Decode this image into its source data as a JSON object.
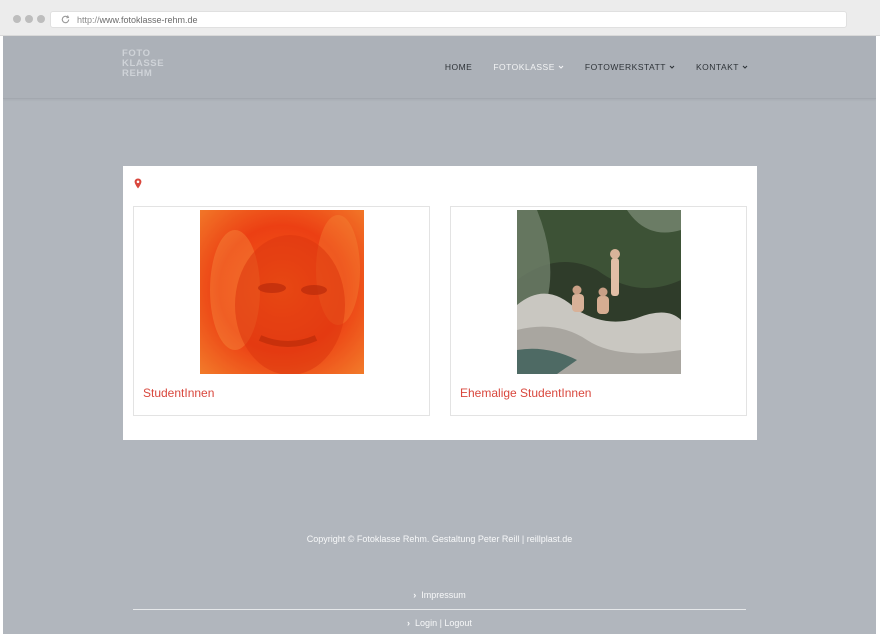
{
  "browser": {
    "url_prefix": "http://",
    "url_host": "www.fotoklasse-rehm.de"
  },
  "site": {
    "logo_lines": [
      "FOTO",
      "KLASSE",
      "REHM"
    ],
    "nav": [
      {
        "label": "HOME",
        "dropdown": false,
        "active": false
      },
      {
        "label": "FOTOKLASSE",
        "dropdown": true,
        "active": true
      },
      {
        "label": "FOTOWERKSTATT",
        "dropdown": true,
        "active": false
      },
      {
        "label": "KONTAKT",
        "dropdown": true,
        "active": false
      }
    ]
  },
  "content": {
    "tiles": [
      {
        "label": "StudentInnen"
      },
      {
        "label": "Ehemalige StudentInnen"
      }
    ]
  },
  "footer": {
    "copyright": "Copyright © Fotoklasse Rehm. Gestaltung Peter Reill | reillplast.de",
    "impressum": "Impressum",
    "login": "Login | Logout"
  },
  "colors": {
    "accent": "#d9473d",
    "page_bg": "#b1b6bd"
  }
}
